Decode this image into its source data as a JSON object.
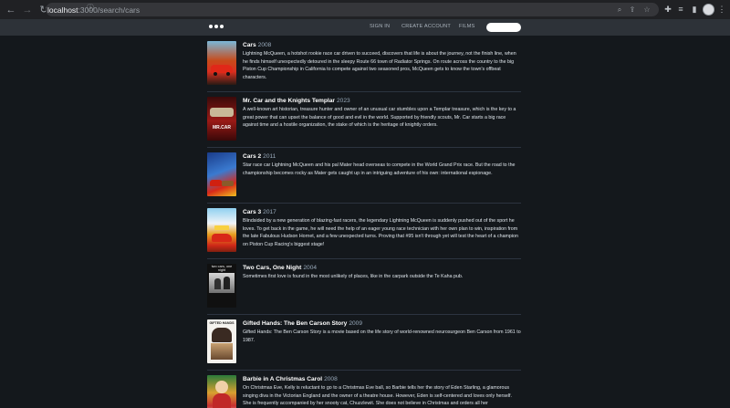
{
  "browser": {
    "url_host": "localhost",
    "url_path": ":3000/search/cars",
    "back_icon": "back-arrow-icon",
    "forward_icon": "forward-arrow-icon",
    "reload_icon": "reload-icon"
  },
  "nav": {
    "sign_in": "SIGN IN",
    "create_account": "CREATE ACCOUNT",
    "films": "FILMS",
    "search_value": ""
  },
  "results": [
    {
      "title": "Cars",
      "year": "2008",
      "overview": "Lightning McQueen, a hotshot rookie race car driven to succeed, discovers that life is about the journey, not the finish line, when he finds himself unexpectedly detoured in the sleepy Route 66 town of Radiator Springs. On route across the country to the big Piston Cup Championship in California to compete against two seasoned pros, McQueen gets to know the town's offbeat characters."
    },
    {
      "title": "Mr. Car and the Knights Templar",
      "year": "2023",
      "overview": "A well-known art historian, treasure hunter and owner of an unusual car stumbles upon a Templar treasure, which is the key to a great power that can upset the balance of good and evil in the world. Supported by friendly scouts, Mr. Car starts a big race against time and a hostile organization, the stake of which is the heritage of knightly orders.",
      "poster_text": "MR.CAR"
    },
    {
      "title": "Cars 2",
      "year": "2011",
      "overview": "Star race car Lightning McQueen and his pal Mater head overseas to compete in the World Grand Prix race. But the road to the championship becomes rocky as Mater gets caught up in an intriguing adventure of his own: international espionage."
    },
    {
      "title": "Cars 3",
      "year": "2017",
      "overview": "Blindsided by a new generation of blazing-fast racers, the legendary Lightning McQueen is suddenly pushed out of the sport he loves. To get back in the game, he will need the help of an eager young race technician with her own plan to win, inspiration from the late Fabulous Hudson Hornet, and a few unexpected turns. Proving that #95 isn't through yet will test the heart of a champion on Piston Cup Racing's biggest stage!"
    },
    {
      "title": "Two Cars, One Night",
      "year": "2004",
      "overview": "Sometimes first love is found in the most unlikely of places, like in the carpark outside the Te Kaha pub.",
      "poster_text": "two cars, one night"
    },
    {
      "title": "Gifted Hands: The Ben Carson Story",
      "year": "2009",
      "overview": "Gifted Hands: The Ben Carson Story is a movie based on the life story of world-renowned neurosurgeon Ben Carson from 1961 to 1987.",
      "poster_text": "GIFTED HANDS"
    },
    {
      "title": "Barbie in A Christmas Carol",
      "year": "2008",
      "overview": "On Christmas Eve, Kelly is reluctant to go to a Christmas Eve ball, so Barbie tells her the story of Eden Starling, a glamorous singing diva in the Victorian England and the owner of a theatre house. However, Eden is self-centered and loves only herself. She is frequently accompanied by her snooty cat, Chuzzlewit. She does not believe in Christmas and orders all her"
    }
  ],
  "colors": {
    "page_bg": "#14181c",
    "nav_bg": "#2d3238",
    "browser_bg": "#202124",
    "divider": "#2c3440"
  }
}
